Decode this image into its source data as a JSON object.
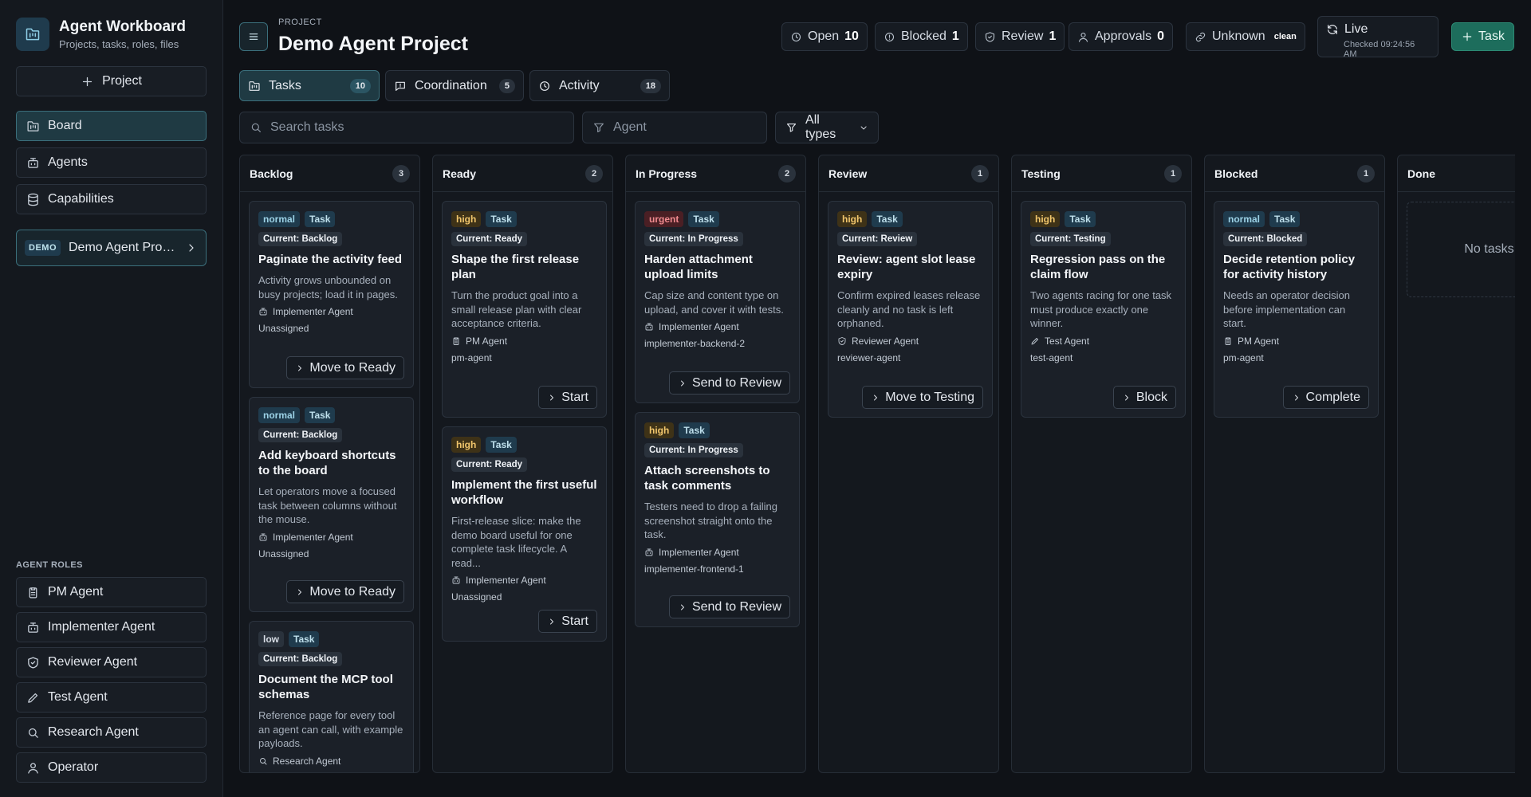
{
  "app": {
    "name": "Agent Workboard",
    "subtitle": "Projects, tasks, roles, files"
  },
  "sidebar": {
    "new_project": "Project",
    "nav": [
      {
        "label": "Board",
        "icon": "board-icon",
        "active": true
      },
      {
        "label": "Agents",
        "icon": "bot-icon"
      },
      {
        "label": "Capabilities",
        "icon": "database-icon"
      }
    ],
    "project": {
      "badge": "DEMO",
      "name": "Demo Agent Project"
    },
    "roles_label": "AGENT ROLES",
    "roles": [
      {
        "label": "PM Agent",
        "icon": "clipboard-icon"
      },
      {
        "label": "Implementer Agent",
        "icon": "bot-icon"
      },
      {
        "label": "Reviewer Agent",
        "icon": "shield-icon"
      },
      {
        "label": "Test Agent",
        "icon": "pen-icon"
      },
      {
        "label": "Research Agent",
        "icon": "search-icon"
      },
      {
        "label": "Operator",
        "icon": "user-icon"
      }
    ]
  },
  "header": {
    "project_label": "PROJECT",
    "project_title": "Demo Agent Project",
    "stats": {
      "open": {
        "label": "Open",
        "count": "10"
      },
      "blocked": {
        "label": "Blocked",
        "count": "1"
      },
      "review": {
        "label": "Review",
        "count": "1"
      },
      "approvals": {
        "label": "Approvals",
        "count": "0"
      }
    },
    "git": {
      "label": "Unknown",
      "state": "clean"
    },
    "live": {
      "label": "Live",
      "checked": "Checked 09:24:56 AM"
    },
    "new_task": "Task"
  },
  "tabs": [
    {
      "label": "Tasks",
      "count": "10",
      "active": true
    },
    {
      "label": "Coordination",
      "count": "5"
    },
    {
      "label": "Activity",
      "count": "18"
    }
  ],
  "filters": {
    "search_placeholder": "Search tasks",
    "agent_placeholder": "Agent",
    "type_value": "All types"
  },
  "columns": [
    {
      "title": "Backlog",
      "count": "3"
    },
    {
      "title": "Ready",
      "count": "2"
    },
    {
      "title": "In Progress",
      "count": "2"
    },
    {
      "title": "Review",
      "count": "1"
    },
    {
      "title": "Testing",
      "count": "1"
    },
    {
      "title": "Blocked",
      "count": "1"
    },
    {
      "title": "Done",
      "count": "",
      "empty": "No tasks"
    }
  ],
  "cards": {
    "c1": {
      "priority": "normal",
      "type": "Task",
      "status": "Current: Backlog",
      "title": "Paginate the activity feed",
      "desc": "Activity grows unbounded on busy projects; load it in pages.",
      "agent": "Implementer Agent",
      "assignee": "Unassigned",
      "action": "Move to Ready"
    },
    "c2": {
      "priority": "normal",
      "type": "Task",
      "status": "Current: Backlog",
      "title": "Add keyboard shortcuts to the board",
      "desc": "Let operators move a focused task between columns without the mouse.",
      "agent": "Implementer Agent",
      "assignee": "Unassigned",
      "action": "Move to Ready"
    },
    "c3": {
      "priority": "low",
      "type": "Task",
      "status": "Current: Backlog",
      "title": "Document the MCP tool schemas",
      "desc": "Reference page for every tool an agent can call, with example payloads.",
      "agent": "Research Agent"
    },
    "c4": {
      "priority": "high",
      "type": "Task",
      "status": "Current: Ready",
      "title": "Shape the first release plan",
      "desc": "Turn the product goal into a small release plan with clear acceptance criteria.",
      "agent": "PM Agent",
      "assignee": "pm-agent",
      "action": "Start"
    },
    "c5": {
      "priority": "high",
      "type": "Task",
      "status": "Current: Ready",
      "title": "Implement the first useful workflow",
      "desc": "First-release slice: make the demo board useful for one complete task lifecycle. A read...",
      "agent": "Implementer Agent",
      "assignee": "Unassigned",
      "action": "Start"
    },
    "c6": {
      "priority": "urgent",
      "type": "Task",
      "status": "Current: In Progress",
      "title": "Harden attachment upload limits",
      "desc": "Cap size and content type on upload, and cover it with tests.",
      "agent": "Implementer Agent",
      "assignee": "implementer-backend-2",
      "action": "Send to Review"
    },
    "c7": {
      "priority": "high",
      "type": "Task",
      "status": "Current: In Progress",
      "title": "Attach screenshots to task comments",
      "desc": "Testers need to drop a failing screenshot straight onto the task.",
      "agent": "Implementer Agent",
      "assignee": "implementer-frontend-1",
      "action": "Send to Review"
    },
    "c8": {
      "priority": "high",
      "type": "Task",
      "status": "Current: Review",
      "title": "Review: agent slot lease expiry",
      "desc": "Confirm expired leases release cleanly and no task is left orphaned.",
      "agent": "Reviewer Agent",
      "assignee": "reviewer-agent",
      "action": "Move to Testing"
    },
    "c9": {
      "priority": "high",
      "type": "Task",
      "status": "Current: Testing",
      "title": "Regression pass on the claim flow",
      "desc": "Two agents racing for one task must produce exactly one winner.",
      "agent": "Test Agent",
      "assignee": "test-agent",
      "action": "Block"
    },
    "c10": {
      "priority": "normal",
      "type": "Task",
      "status": "Current: Blocked",
      "title": "Decide retention policy for activity history",
      "desc": "Needs an operator decision before implementation can start.",
      "agent": "PM Agent",
      "assignee": "pm-agent",
      "action": "Complete"
    }
  }
}
